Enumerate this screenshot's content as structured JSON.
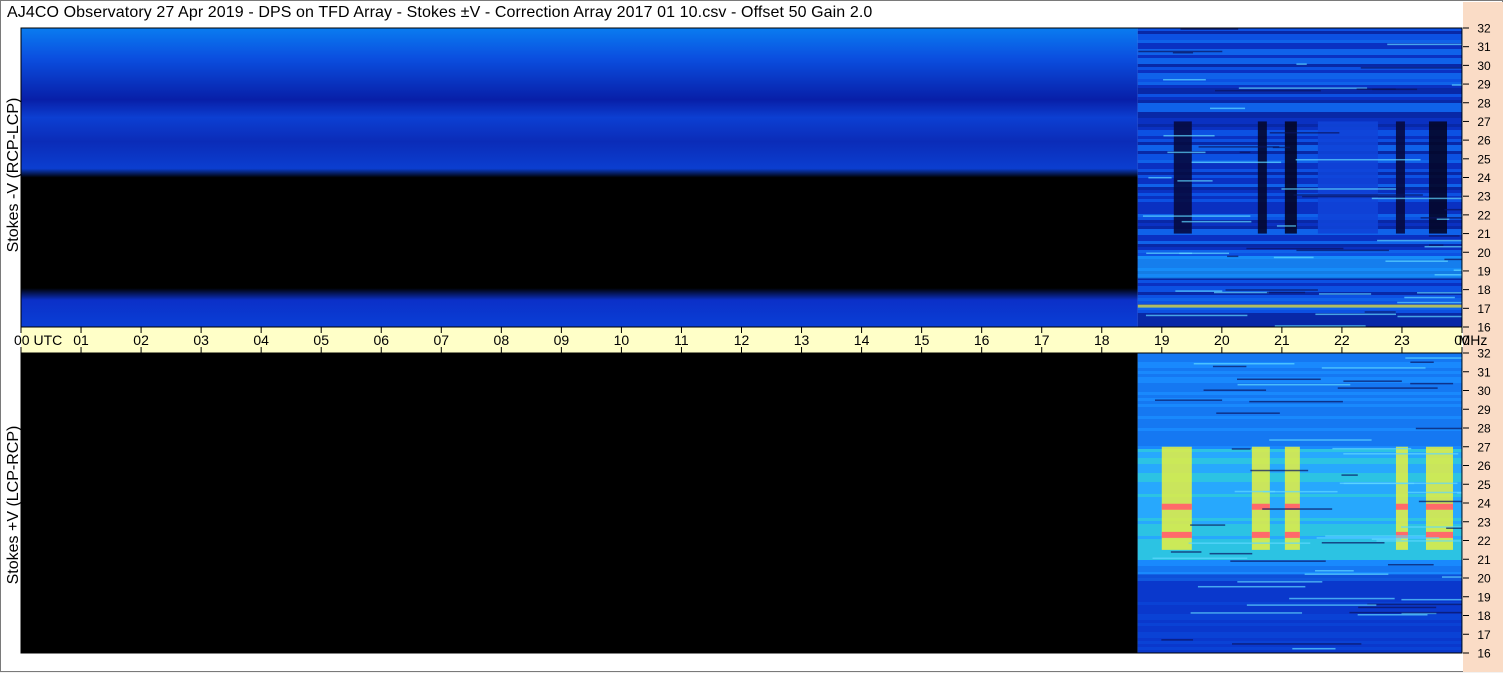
{
  "title": "AJ4CO Observatory  27 Apr 2019  -  DPS on TFD Array  -  Stokes ±V  -  Correction Array 2017 01 10.csv  -  Offset 50  Gain 2.0",
  "colors": {
    "time_axis_band": "#ffffc8",
    "freq_axis_band": "#fadcc6",
    "no_data": "#000000",
    "low": "#0a2bd4",
    "mid": "#1f8cff",
    "high": "#e8f040",
    "peak": "#ff6a6a"
  },
  "chart_data": [
    {
      "type": "heatmap",
      "ylabel": "Stokes -V (RCP-LCP)",
      "x_ticks": [
        "00 UTC",
        "01",
        "02",
        "03",
        "04",
        "05",
        "06",
        "07",
        "08",
        "09",
        "10",
        "11",
        "12",
        "13",
        "14",
        "15",
        "16",
        "17",
        "18",
        "19",
        "20",
        "21",
        "22",
        "23",
        "00"
      ],
      "x_unit_label": "MHz",
      "xlim_hours_utc": [
        0,
        24
      ],
      "ylim_mhz": [
        16,
        32
      ],
      "y_ticks": [
        "32",
        "31",
        "30",
        "29",
        "28",
        "27",
        "26",
        "25",
        "24",
        "23",
        "22",
        "21",
        "20",
        "19",
        "18",
        "17",
        "16"
      ],
      "data_start_hour_utc": 18.6
    },
    {
      "type": "heatmap",
      "ylabel": "Stokes +V (LCP-RCP)",
      "x_ticks": [
        "00 UTC",
        "01",
        "02",
        "03",
        "04",
        "05",
        "06",
        "07",
        "08",
        "09",
        "10",
        "11",
        "12",
        "13",
        "14",
        "15",
        "16",
        "17",
        "18",
        "19",
        "20",
        "21",
        "22",
        "23",
        "00"
      ],
      "x_unit_label": "MHz",
      "xlim_hours_utc": [
        0,
        24
      ],
      "ylim_mhz": [
        16,
        32
      ],
      "y_ticks": [
        "32",
        "31",
        "30",
        "29",
        "28",
        "27",
        "26",
        "25",
        "24",
        "23",
        "22",
        "21",
        "20",
        "19",
        "18",
        "17",
        "16"
      ],
      "data_start_hour_utc": 18.6
    }
  ]
}
